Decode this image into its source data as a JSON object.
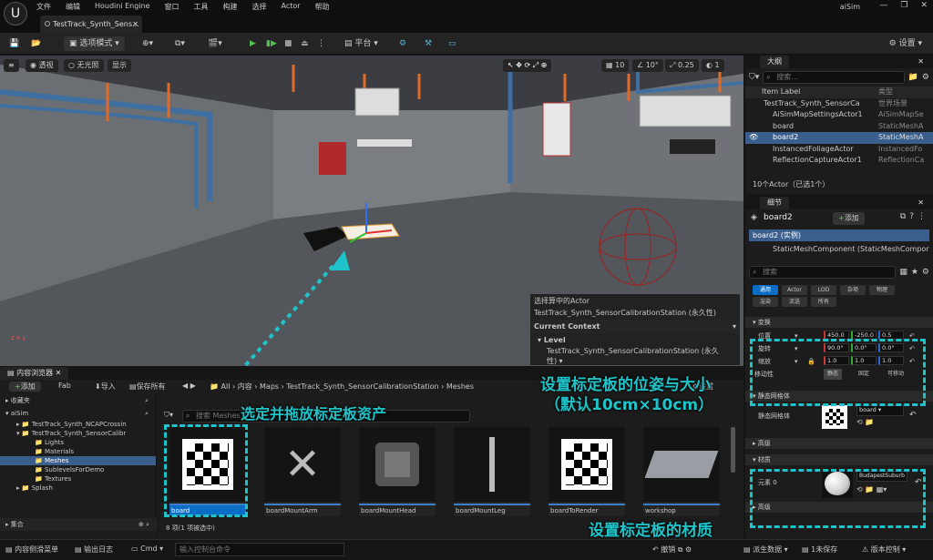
{
  "menubar": {
    "logo": "U",
    "items": [
      "文件",
      "编辑",
      "Houdini Engine",
      "窗口",
      "工具",
      "构建",
      "选择",
      "Actor",
      "帮助"
    ],
    "app_name": "aiSim",
    "window_controls": [
      "—",
      "❐",
      "✕"
    ]
  },
  "tab": {
    "title": "TestTrack_Synth_Sens...",
    "close": "✕"
  },
  "toolbar": {
    "mode": "选项模式",
    "platform": "平台",
    "settings": "设置"
  },
  "viewport": {
    "perspective": "透视",
    "lit": "无光照",
    "show": "显示",
    "grid_snap": "10",
    "rot_snap": "10°",
    "scale_snap": "0.25",
    "cam_speed": "1",
    "axis": "z x y"
  },
  "context": {
    "line1": "选择算中的Actor",
    "line2": "TestTrack_Synth_SensorCalibrationStation (永久性)",
    "current_context": "Current Context",
    "level_label": "Level",
    "level_value": "TestTrack_Synth_SensorCalibrationStation (永久性)"
  },
  "outliner": {
    "title": "大纲",
    "search": "搜索...",
    "col_label": "Item Label",
    "col_type": "类型",
    "rows": [
      {
        "name": "TestTrack_Synth_SensorCa",
        "type": "世界场景"
      },
      {
        "name": "AiSimMapSettingsActor1",
        "type": "AiSimMapSe"
      },
      {
        "name": "board",
        "type": "StaticMeshA"
      },
      {
        "name": "board2",
        "type": "StaticMeshA"
      },
      {
        "name": "InstancedFoliageActor",
        "type": "InstancedFo"
      },
      {
        "name": "ReflectionCaptureActor1",
        "type": "ReflectionCa"
      }
    ],
    "footer": "10个Actor（已选1个）"
  },
  "details": {
    "title": "细节",
    "actor": "board2",
    "add": "添加",
    "instance": "board2 (实例)",
    "component": "StaticMeshComponent (StaticMeshCompor",
    "search": "搜索",
    "cats": [
      "通用",
      "Actor",
      "LOD",
      "杂项",
      "物理",
      "渲染",
      "流送",
      "所有"
    ],
    "transform_label": "变换",
    "location": {
      "label": "位置",
      "x": "450.0",
      "y": "-250.0",
      "z": "0.5"
    },
    "rotation": {
      "label": "旋转",
      "x": "90.0°",
      "y": "0.0°",
      "z": "0.0°"
    },
    "scale": {
      "label": "缩放",
      "x": "1.0",
      "y": "1.0",
      "z": "1.0"
    },
    "mobility": {
      "label": "移动性",
      "static": "静态",
      "fixed": "固定",
      "movable": "可移动"
    },
    "static_mesh_section": "静态网格体",
    "static_mesh_label": "静态网格体",
    "static_mesh_value": "board",
    "advanced": "高级",
    "materials_section": "材质",
    "element0": "元素 0",
    "material_value": "BudapestSuburb",
    "advanced2": "高级"
  },
  "browser": {
    "tab": "内容浏览器",
    "add": "添加",
    "fab": "Fab",
    "import": "导入",
    "save_all": "保存所有",
    "path": [
      "All",
      "内容",
      "Maps",
      "TestTrack_Synth_SensorCalibrationStation",
      "Meshes"
    ],
    "settings": "设置",
    "favorites": "收藏夹",
    "root": "aiSim",
    "folders": [
      "TestTrack_Synth_NCAPCrossin",
      "TestTrack_Synth_SensorCalibr",
      "Lights",
      "Materials",
      "Meshes",
      "SublevelsForDemo",
      "Textures",
      "Splash"
    ],
    "collections": "集合",
    "search": "搜索 Meshes",
    "assets": [
      "board",
      "boardMountArm",
      "boardMountHead",
      "boardMountLeg",
      "boardToRender",
      "workshop"
    ],
    "count": "8 项(1 项被选中)"
  },
  "status": {
    "drawer": "内容侧滑菜单",
    "output": "输出日志",
    "cmd": "Cmd",
    "console": "输入控制台命令",
    "undo": "撤销",
    "derived": "派生数据",
    "unsaved": "1未保存",
    "vcs": "版本控制"
  },
  "annotations": {
    "drag": "选定并拖放标定板资产",
    "transform_line1": "设置标定板的位姿与大小",
    "transform_line2": "（默认10cm×10cm）",
    "material": "设置标定板的材质"
  },
  "colors": {
    "accent": "#0a6cc4",
    "annotation": "#1ec4c9"
  }
}
